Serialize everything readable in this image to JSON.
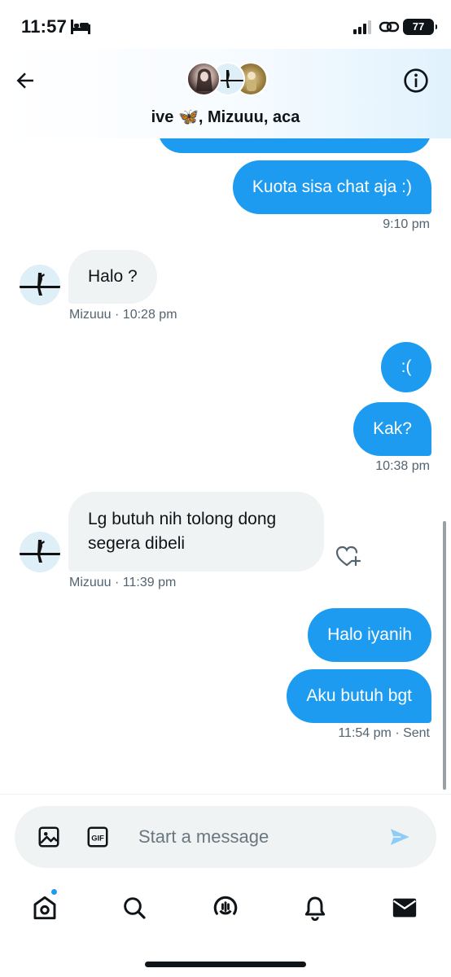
{
  "status_bar": {
    "time": "11:57",
    "battery": "77",
    "icons": [
      "bed-icon",
      "signal-icon",
      "link-icon",
      "battery-icon"
    ]
  },
  "header": {
    "group_name": "ive 🦋, Mizuuu, aca",
    "back_icon": "arrow-left-icon",
    "info_icon": "info-icon"
  },
  "messages": {
    "out_1": "Kuota sisa chat aja :)",
    "out_1_time": "9:10 pm",
    "in_1": "Halo ?",
    "in_1_sender": "Mizuuu",
    "in_1_time": "· 10:28 pm",
    "out_2": ":(",
    "out_3": "Kak?",
    "out_3_time": "10:38 pm",
    "in_2_line1": "Lg butuh nih tolong dong",
    "in_2_line2": "segera dibeli",
    "in_2_sender": "Mizuuu",
    "in_2_time": "· 11:39 pm",
    "out_4": "Halo iyanih",
    "out_5": "Aku butuh bgt",
    "out_5_time": "11:54 pm",
    "out_5_status": "· Sent"
  },
  "composer": {
    "placeholder": "Start a message",
    "value": "",
    "gif_label": "GIF"
  },
  "nav": {
    "items": [
      "home-icon",
      "search-icon",
      "spaces-icon",
      "notifications-icon",
      "messages-icon"
    ],
    "home_has_notification": true
  },
  "colors": {
    "accent": "#1d9bf0",
    "bubble_in": "#eff3f4",
    "meta_text": "#536471"
  }
}
